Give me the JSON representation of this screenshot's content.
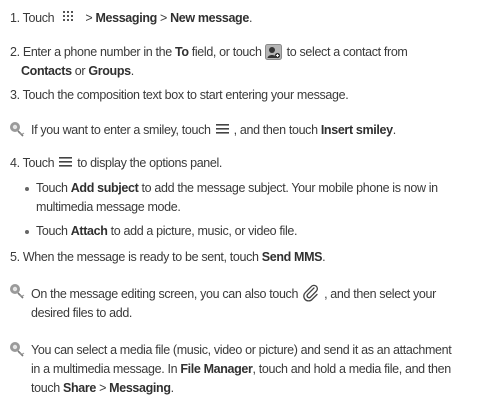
{
  "steps": {
    "s1": {
      "num": "1. Touch",
      "sep1": " > ",
      "b1": "Messaging",
      "sep2": " > ",
      "b2": "New message",
      "end": "."
    },
    "s2": {
      "a": "2. Enter a phone number in the ",
      "b1": "To",
      "c": " field, or touch",
      "d": " to select a contact from",
      "b2": "Contacts",
      "e": " or ",
      "b3": "Groups",
      "f": "."
    },
    "s3": {
      "text": "3. Touch the composition text box to start entering your message."
    },
    "tip1": {
      "a": "If you want to enter a smiley, touch",
      "b": ", and then touch ",
      "b1": "Insert smiley",
      "c": "."
    },
    "s4": {
      "a": "4. Touch",
      "b": "to display the options panel."
    },
    "bullet1": {
      "a": "Touch ",
      "b1": "Add subject",
      "c": " to add the message subject. Your mobile phone is now in",
      "d": "multimedia message mode."
    },
    "bullet2": {
      "a": "Touch ",
      "b1": "Attach",
      "c": " to add a picture, music, or video file."
    },
    "s5": {
      "a": "5. When the message is ready to be sent, touch ",
      "b1": "Send MMS",
      "c": "."
    },
    "tip2": {
      "a": "On the message editing screen, you can also touch",
      "b": ", and then select your",
      "c": "desired files to add."
    },
    "tip3": {
      "l1": "You can select a media file (music, video or picture) and send it as an attachment",
      "l2a": "in a multimedia message. In ",
      "b1": "File Manager",
      "l2b": ", touch and hold a media file, and then",
      "l3a": "touch ",
      "b2": "Share",
      "l3b": " > ",
      "b3": "Messaging",
      "l3c": "."
    }
  },
  "icons": {
    "apps": "apps-grid-icon",
    "contact": "contact-picker-icon",
    "menu": "menu-icon",
    "attach": "paperclip-icon",
    "note": "note-icon"
  },
  "colors": {
    "text": "#3a3a3a",
    "icon_bg": "#b5b5b5"
  }
}
